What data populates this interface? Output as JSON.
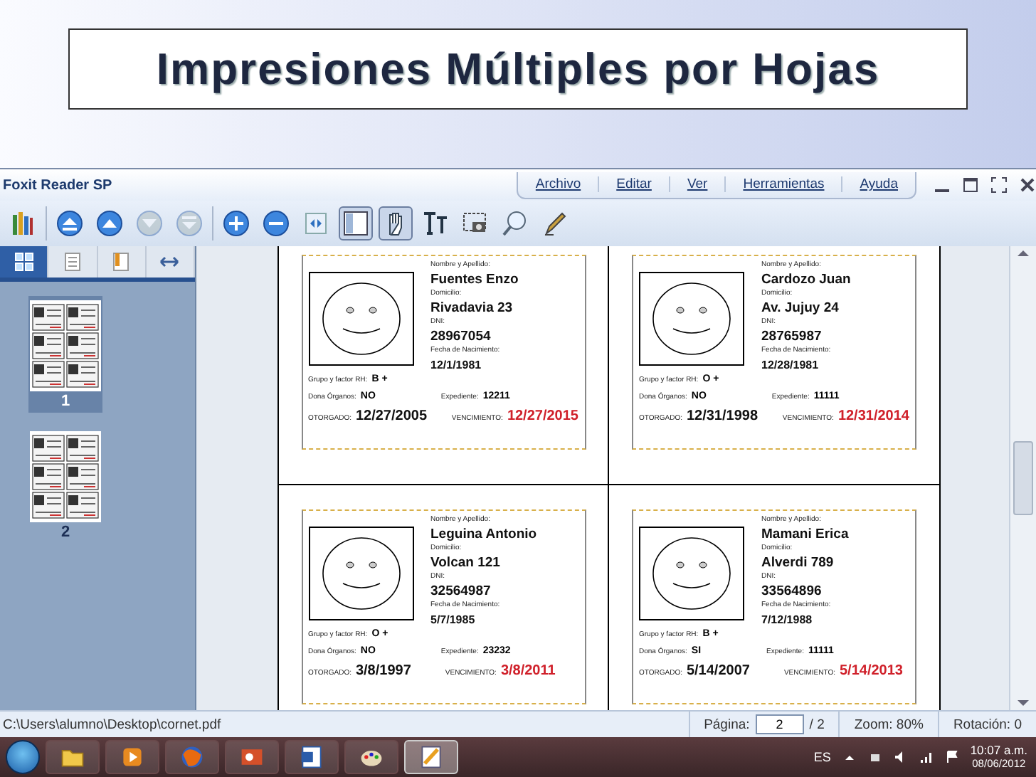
{
  "slide": {
    "title": "Impresiones Múltiples por Hojas"
  },
  "app": {
    "title": "Foxit Reader SP",
    "menu": [
      {
        "label": "Archivo"
      },
      {
        "label": "Editar"
      },
      {
        "label": "Ver"
      },
      {
        "label": "Herramientas"
      },
      {
        "label": "Ayuda"
      }
    ],
    "toolbar": [
      {
        "kind": "books",
        "selected": false,
        "disabled": false
      },
      {
        "kind": "sep"
      },
      {
        "kind": "first",
        "selected": false,
        "disabled": false
      },
      {
        "kind": "prev",
        "selected": false,
        "disabled": false
      },
      {
        "kind": "next",
        "selected": false,
        "disabled": true
      },
      {
        "kind": "last",
        "selected": false,
        "disabled": true
      },
      {
        "kind": "sep"
      },
      {
        "kind": "zoomin",
        "selected": false,
        "disabled": false
      },
      {
        "kind": "zoomout",
        "selected": false,
        "disabled": false
      },
      {
        "kind": "fit",
        "selected": false,
        "disabled": false
      },
      {
        "kind": "single",
        "selected": true,
        "disabled": false
      },
      {
        "kind": "hand",
        "selected": true,
        "disabled": false
      },
      {
        "kind": "text",
        "selected": false,
        "disabled": false
      },
      {
        "kind": "snapshot",
        "selected": false,
        "disabled": false
      },
      {
        "kind": "search",
        "selected": false,
        "disabled": false
      },
      {
        "kind": "pen",
        "selected": false,
        "disabled": false
      }
    ],
    "panel_tabs": [
      {
        "kind": "thumbs",
        "selected": true
      },
      {
        "kind": "pages",
        "selected": false
      },
      {
        "kind": "bookmarks",
        "selected": false
      },
      {
        "kind": "expand",
        "selected": false
      }
    ],
    "thumbnails": [
      {
        "label": "1",
        "selected": true
      },
      {
        "label": "2",
        "selected": false
      }
    ],
    "cards": [
      {
        "name_label": "Nombre y Apellido:",
        "name": "Fuentes Enzo",
        "address_label": "Domicilio:",
        "address": "Rivadavia 23",
        "dni_label": "DNI:",
        "dni": "28967054",
        "birth_label": "Fecha de Nacimiento:",
        "birth": "12/1/1981",
        "blood_label": "Grupo y factor RH:",
        "blood": "B +",
        "donor_label": "Dona Órganos:",
        "donor": "NO",
        "file_label": "Expediente:",
        "file": "12211",
        "issued_label": "OTORGADO:",
        "issued": "12/27/2005",
        "expires_label": "VENCIMIENTO:",
        "expires": "12/27/2015"
      },
      {
        "name_label": "Nombre y Apellido:",
        "name": "Cardozo Juan",
        "address_label": "Domicilio:",
        "address": "Av. Jujuy 24",
        "dni_label": "DNI:",
        "dni": "28765987",
        "birth_label": "Fecha de Nacimiento:",
        "birth": "12/28/1981",
        "blood_label": "Grupo y factor RH:",
        "blood": "O +",
        "donor_label": "Dona Órganos:",
        "donor": "NO",
        "file_label": "Expediente:",
        "file": "11111",
        "issued_label": "OTORGADO:",
        "issued": "12/31/1998",
        "expires_label": "VENCIMIENTO:",
        "expires": "12/31/2014"
      },
      {
        "name_label": "Nombre y Apellido:",
        "name": "Leguina Antonio",
        "address_label": "Domicilio:",
        "address": "Volcan 121",
        "dni_label": "DNI:",
        "dni": "32564987",
        "birth_label": "Fecha de Nacimiento:",
        "birth": "5/7/1985",
        "blood_label": "Grupo y factor RH:",
        "blood": "O +",
        "donor_label": "Dona Órganos:",
        "donor": "NO",
        "file_label": "Expediente:",
        "file": "23232",
        "issued_label": "OTORGADO:",
        "issued": "3/8/1997",
        "expires_label": "VENCIMIENTO:",
        "expires": "3/8/2011"
      },
      {
        "name_label": "Nombre y Apellido:",
        "name": "Mamani Erica",
        "address_label": "Domicilio:",
        "address": "Alverdi 789",
        "dni_label": "DNI:",
        "dni": "33564896",
        "birth_label": "Fecha de Nacimiento:",
        "birth": "7/12/1988",
        "blood_label": "Grupo y factor RH:",
        "blood": "B +",
        "donor_label": "Dona Órganos:",
        "donor": "SI",
        "file_label": "Expediente:",
        "file": "11111",
        "issued_label": "OTORGADO:",
        "issued": "5/14/2007",
        "expires_label": "VENCIMIENTO:",
        "expires": "5/14/2013"
      }
    ],
    "status": {
      "path": "C:\\Users\\alumno\\Desktop\\cornet.pdf",
      "page_label": "Página:",
      "page_value": "2",
      "page_total": "/ 2",
      "zoom": "Zoom: 80%",
      "rotation": "Rotación: 0"
    }
  },
  "taskbar": {
    "apps": [
      {
        "kind": "folder",
        "selected": false
      },
      {
        "kind": "media",
        "selected": false
      },
      {
        "kind": "browser",
        "selected": false
      },
      {
        "kind": "slides",
        "selected": false
      },
      {
        "kind": "word",
        "selected": false
      },
      {
        "kind": "paint",
        "selected": false
      },
      {
        "kind": "reader",
        "selected": true
      }
    ],
    "language": "ES",
    "time": "10:07 a.m.",
    "date": "08/06/2012"
  }
}
